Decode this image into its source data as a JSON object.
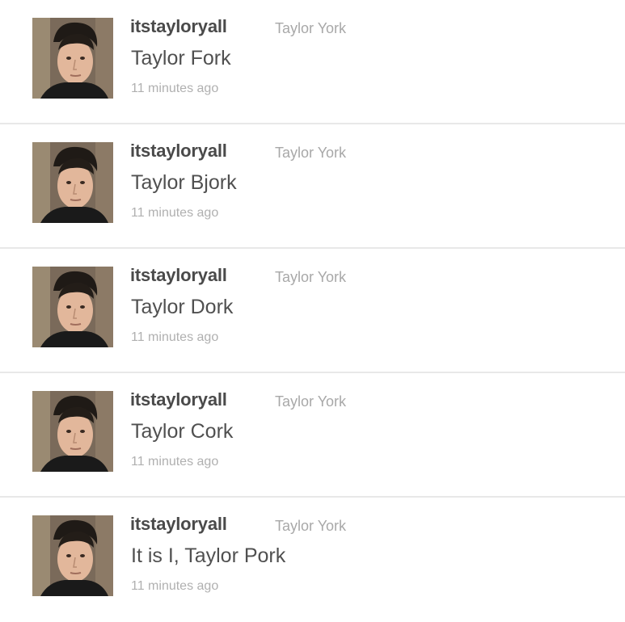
{
  "tweets": [
    {
      "screen_name": "itstayloryall",
      "full_name": "Taylor York",
      "text": "Taylor Fork",
      "time": "11 minutes ago"
    },
    {
      "screen_name": "itstayloryall",
      "full_name": "Taylor York",
      "text": "Taylor Bjork",
      "time": "11 minutes ago"
    },
    {
      "screen_name": "itstayloryall",
      "full_name": "Taylor York",
      "text": "Taylor Dork",
      "time": "11 minutes ago"
    },
    {
      "screen_name": "itstayloryall",
      "full_name": "Taylor York",
      "text": "Taylor Cork",
      "time": "11 minutes ago"
    },
    {
      "screen_name": "itstayloryall",
      "full_name": "Taylor York",
      "text": "It is I, Taylor Pork",
      "time": "11 minutes ago"
    }
  ]
}
